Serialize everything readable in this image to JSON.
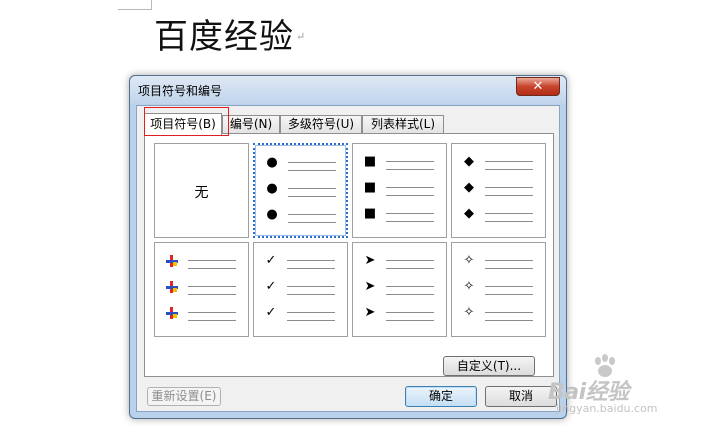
{
  "document": {
    "title": "百度经验",
    "paragraph_mark": "↵"
  },
  "dialog": {
    "title": "项目符号和编号",
    "close_glyph": "✕",
    "tabs": [
      {
        "label": "项目符号(B)",
        "active": true
      },
      {
        "label": "编号(N)",
        "active": false
      },
      {
        "label": "多级符号(U)",
        "active": false
      },
      {
        "label": "列表样式(L)",
        "active": false
      }
    ],
    "gallery": [
      {
        "kind": "none",
        "label": "无"
      },
      {
        "kind": "bullet",
        "glyph": "●",
        "icon": "filled-circle-icon",
        "selected": true
      },
      {
        "kind": "bullet",
        "glyph": "■",
        "icon": "filled-square-icon"
      },
      {
        "kind": "bullet",
        "glyph": "◆",
        "icon": "filled-diamond-icon"
      },
      {
        "kind": "bullet",
        "glyph": "",
        "icon": "colored-cross-icon",
        "colors": [
          "#e0262b",
          "#2a4fbf",
          "#f2c200"
        ]
      },
      {
        "kind": "bullet",
        "glyph": "✓",
        "icon": "checkmark-icon"
      },
      {
        "kind": "bullet",
        "glyph": "➤",
        "icon": "arrowhead-icon"
      },
      {
        "kind": "bullet",
        "glyph": "✧",
        "icon": "four-point-star-icon"
      }
    ],
    "buttons": {
      "customize": "自定义(T)...",
      "reset": "重新设置(E)",
      "ok": "确定",
      "cancel": "取消"
    }
  },
  "watermark": {
    "brand": "Bai",
    "brand_tail": "经验",
    "url": "jingyan.baidu.com",
    "icon": "paw-icon"
  },
  "colors": {
    "selection_border": "#2e6dc8",
    "highlight_box": "#e02020",
    "dialog_frame": "#b9d1ea",
    "close_button": "#c8442c"
  }
}
